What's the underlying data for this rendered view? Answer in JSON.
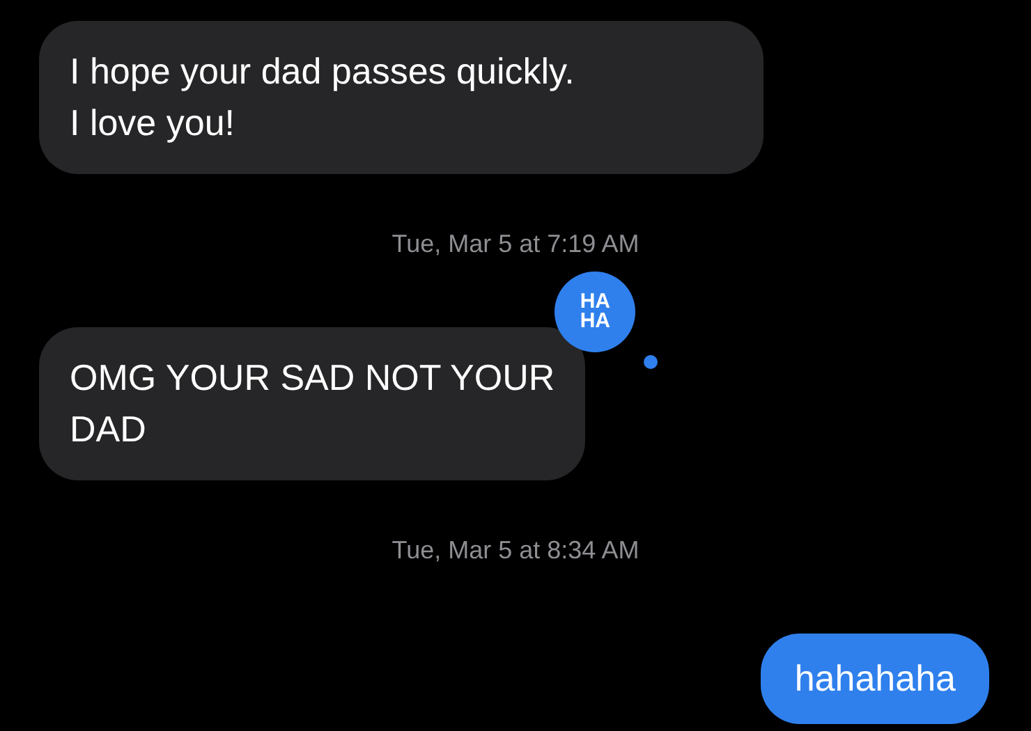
{
  "messages": [
    {
      "kind": "received",
      "text": "I hope your dad passes quickly.\nI love you!"
    },
    {
      "kind": "timestamp",
      "text": "Tue, Mar 5 at 7:19 AM"
    },
    {
      "kind": "received",
      "text": "OMG YOUR SAD NOT YOUR\nDAD",
      "tapback": "HA HA"
    },
    {
      "kind": "timestamp",
      "text": "Tue, Mar 5 at 8:34 AM"
    },
    {
      "kind": "sent",
      "text": "hahahaha"
    }
  ]
}
